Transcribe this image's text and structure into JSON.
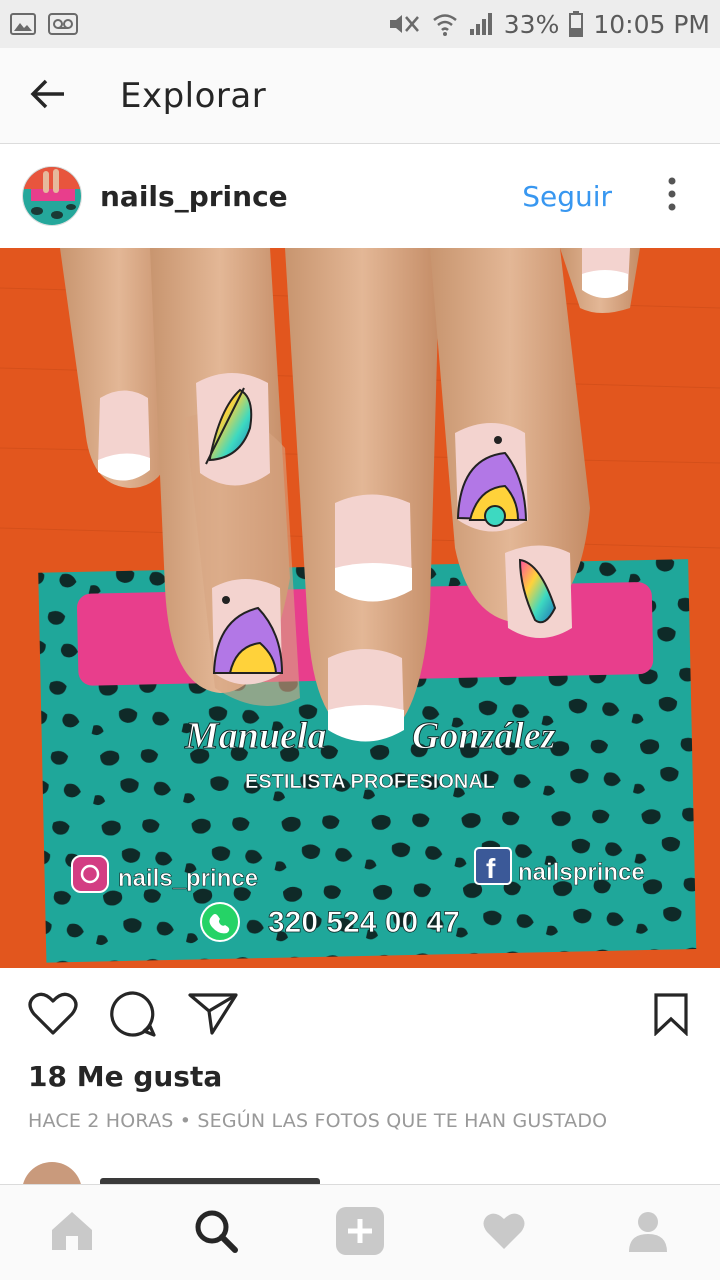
{
  "status_bar": {
    "battery": "33%",
    "time": "10:05 PM",
    "left_icons": [
      "image-icon",
      "voicemail-icon"
    ],
    "right_icons": [
      "mute-icon",
      "wifi-icon",
      "signal-icon",
      "battery-icon"
    ]
  },
  "app_bar": {
    "title": "Explorar",
    "back_icon": "arrow-left-icon"
  },
  "post": {
    "username": "nails_prince",
    "follow_label": "Seguir",
    "likes": "18 Me gusta",
    "meta": "HACE 2 HORAS • SEGÚN LAS FOTOS QUE TE HAN GUSTADO",
    "card": {
      "first_name": "Manuela",
      "last_name": "González",
      "role": "ESTILISTA PROFESIONAL",
      "instagram": "nails_prince",
      "facebook": "nailsprince",
      "phone": "320 524 00 47"
    }
  },
  "actions": [
    "heart-icon",
    "comment-icon",
    "share-icon",
    "bookmark-icon"
  ],
  "bottom_nav": [
    "home-icon",
    "search-icon",
    "add-icon",
    "heart-icon",
    "profile-icon"
  ],
  "colors": {
    "link_blue": "#3897f0",
    "text": "#262626",
    "muted": "#999999",
    "card_teal": "#1fa79a",
    "card_pink": "#e83e8c",
    "background_orange": "#e2561e"
  }
}
